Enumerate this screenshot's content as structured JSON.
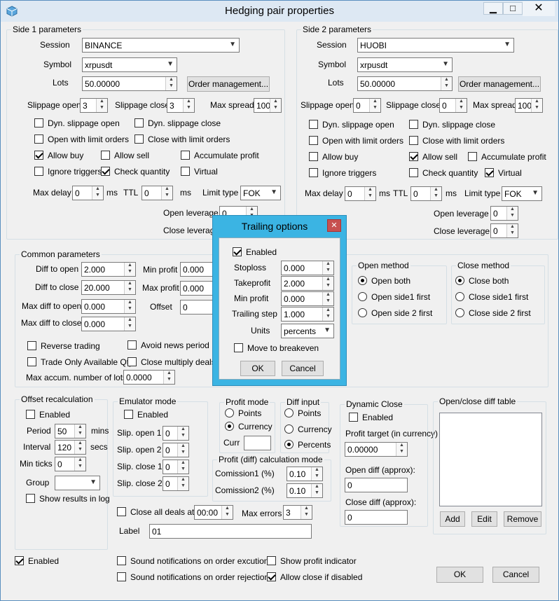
{
  "window": {
    "title": "Hedging pair properties"
  },
  "side1": {
    "title": "Side 1 parameters",
    "session_label": "Session",
    "session": "BINANCE",
    "symbol_label": "Symbol",
    "symbol": "xrpusdt",
    "lots_label": "Lots",
    "lots": "50.00000",
    "order_mgmt": "Order management...",
    "slip_open_label": "Slippage open",
    "slip_open": "3",
    "slip_close_label": "Slippage close",
    "slip_close": "3",
    "max_spread_label": "Max spread",
    "max_spread": "100",
    "dyn_open": "Dyn. slippage open",
    "dyn_close": "Dyn. slippage close",
    "open_limit": "Open with limit orders",
    "close_limit": "Close with limit orders",
    "allow_buy": "Allow buy",
    "allow_sell": "Allow sell",
    "accum": "Accumulate profit",
    "ignore": "Ignore triggers",
    "check_qty": "Check quantity",
    "virtual": "Virtual",
    "max_delay_label": "Max delay",
    "max_delay": "0",
    "ms": "ms",
    "ttl_label": "TTL",
    "ttl": "0",
    "limit_type_label": "Limit type",
    "limit_type": "FOK",
    "open_lev_label": "Open leverage",
    "open_lev": "0",
    "close_lev_label": "Close leverage"
  },
  "side2": {
    "title": "Side 2 parameters",
    "session_label": "Session",
    "session": "HUOBI",
    "symbol_label": "Symbol",
    "symbol": "xrpusdt",
    "lots_label": "Lots",
    "lots": "50.00000",
    "order_mgmt": "Order management...",
    "slip_open_label": "Slippage open",
    "slip_open": "0",
    "slip_close_label": "Slippage close",
    "slip_close": "0",
    "max_spread_label": "Max spread",
    "max_spread": "100",
    "dyn_open": "Dyn. slippage open",
    "dyn_close": "Dyn. slippage close",
    "open_limit": "Open with limit orders",
    "close_limit": "Close with limit orders",
    "allow_buy": "Allow buy",
    "allow_sell": "Allow sell",
    "accum": "Accumulate profit",
    "ignore": "Ignore triggers",
    "check_qty": "Check quantity",
    "virtual": "Virtual",
    "max_delay_label": "Max delay",
    "max_delay": "0",
    "ms": "ms",
    "ttl_label": "TTL",
    "ttl": "0",
    "limit_type_label": "Limit type",
    "limit_type": "FOK",
    "open_lev_label": "Open leverage",
    "open_lev": "0",
    "close_lev_label": "Close leverage",
    "close_lev": "0"
  },
  "common": {
    "title": "Common parameters",
    "diff_open_label": "Diff to open",
    "diff_open": "2.000",
    "diff_close_label": "Diff to close",
    "diff_close": "20.000",
    "max_diff_open_label": "Max diff to open",
    "max_diff_open": "0.000",
    "max_diff_close_label": "Max diff to close",
    "max_diff_close": "0.000",
    "min_profit_label": "Min profit",
    "min_profit": "0.000",
    "max_profit_label": "Max profit",
    "max_profit": "0.000",
    "offset_label": "Offset",
    "offset": "0",
    "reverse": "Reverse trading",
    "avoid_news": "Avoid news period",
    "trade_only": "Trade Only Available Qty",
    "close_mult": "Close multiply deals",
    "max_accum_label": "Max accum. number of lots",
    "max_accum": "0.0000"
  },
  "open_method": {
    "title": "Open method",
    "both": "Open both",
    "side1": "Open side1 first",
    "side2": "Open side 2 first"
  },
  "close_method": {
    "title": "Close method",
    "both": "Close both",
    "side1": "Close side1 first",
    "side2": "Close side 2 first"
  },
  "offset_recalc": {
    "title": "Offset recalculation",
    "enabled": "Enabled",
    "period_label": "Period",
    "period": "50",
    "mins": "mins",
    "interval_label": "Interval",
    "interval": "120",
    "secs": "secs",
    "min_ticks_label": "Min ticks",
    "min_ticks": "0",
    "group_label": "Group",
    "show_results": "Show results in log"
  },
  "emulator": {
    "title": "Emulator mode",
    "enabled": "Enabled",
    "slip_open1_label": "Slip. open 1",
    "slip_open1": "0",
    "slip_open2_label": "Slip. open 2",
    "slip_open2": "0",
    "slip_close1_label": "Slip. close 1",
    "slip_close1": "0",
    "slip_close2_label": "Slip. close 2",
    "slip_close2": "0"
  },
  "profit_mode": {
    "title": "Profit mode",
    "points": "Points",
    "currency": "Currency",
    "curr_label": "Curr"
  },
  "diff_input": {
    "title": "Diff input",
    "points": "Points",
    "currency": "Currency",
    "percents": "Percents"
  },
  "calc_mode": {
    "title": "Profit (diff) calculation mode",
    "c1_label": "Comission1 (%)",
    "c1": "0.10",
    "c2_label": "Comission2 (%)",
    "c2": "0.10"
  },
  "dynamic_close": {
    "title": "Dynamic Close",
    "enabled": "Enabled",
    "target_label": "Profit target (in currency)",
    "target": "0.00000",
    "open_diff_label": "Open diff (approx):",
    "open_diff": "0",
    "close_diff_label": "Close diff (approx):",
    "close_diff": "0"
  },
  "diff_table": {
    "title": "Open/close diff table",
    "add": "Add",
    "edit": "Edit",
    "remove": "Remove"
  },
  "misc": {
    "close_all": "Close all deals at",
    "close_time": "00:00",
    "max_errors_label": "Max errors",
    "max_errors": "3",
    "label_label": "Label",
    "label": "01"
  },
  "bottom": {
    "enabled": "Enabled",
    "sound_exec": "Sound notifications on order excution",
    "sound_rej": "Sound notifications on order rejections",
    "show_profit": "Show profit indicator",
    "allow_close": "Allow close if disabled",
    "ok": "OK",
    "cancel": "Cancel"
  },
  "trailing": {
    "title": "Trailing options",
    "enabled": "Enabled",
    "stoploss_label": "Stoploss",
    "stoploss": "0.000",
    "takeprofit_label": "Takeprofit",
    "takeprofit": "2.000",
    "min_profit_label": "Min profit",
    "min_profit": "0.000",
    "step_label": "Trailing step",
    "step": "1.000",
    "units_label": "Units",
    "units": "percents",
    "breakeven": "Move to breakeven",
    "ok": "OK",
    "cancel": "Cancel"
  }
}
